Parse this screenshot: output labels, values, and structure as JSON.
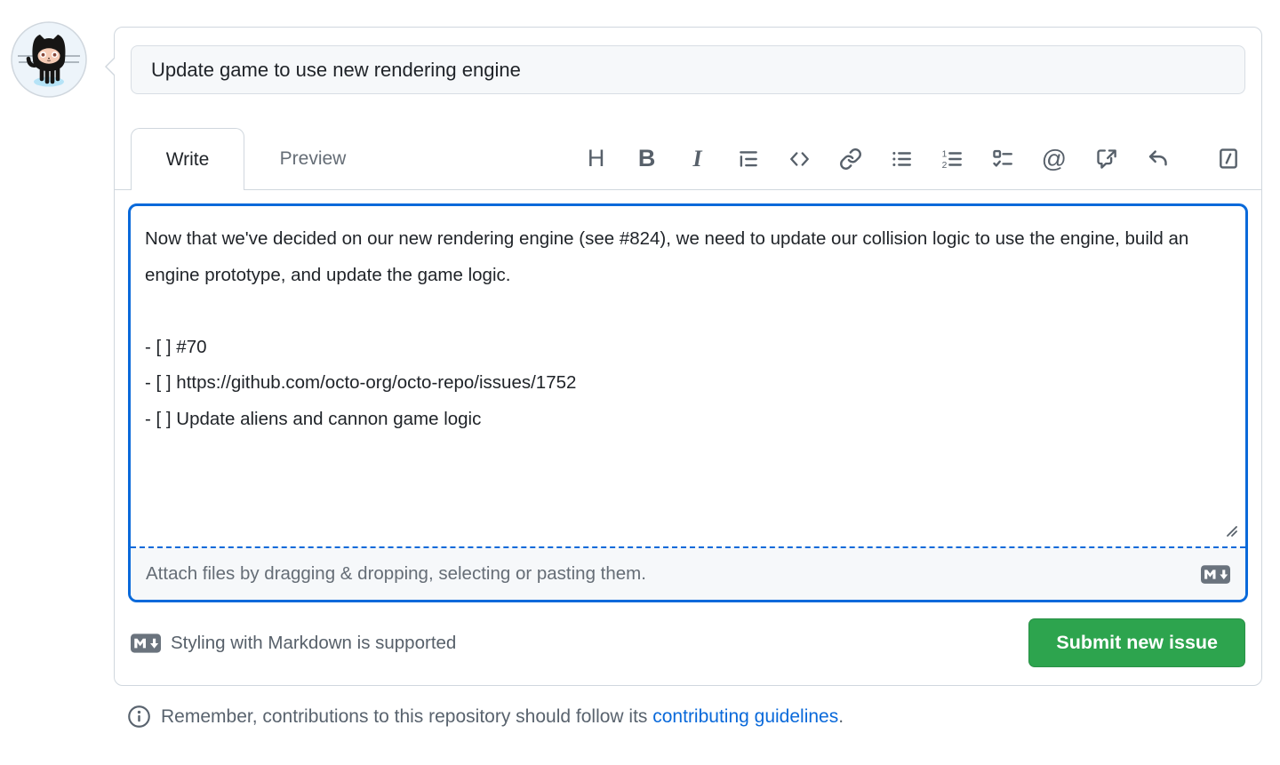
{
  "header": {
    "title_value": "Update game to use new rendering engine"
  },
  "tabs": {
    "write": "Write",
    "preview": "Preview"
  },
  "toolbar": {
    "icons": [
      "heading",
      "bold",
      "italic",
      "quote",
      "code",
      "link",
      "unordered-list",
      "ordered-list",
      "task-list",
      "mention",
      "cross-reference",
      "saved-reply",
      "slash-command"
    ],
    "glyphs": {
      "heading": "H",
      "bold": "B",
      "italic": "I",
      "mention": "@"
    }
  },
  "editor": {
    "body_value": "Now that we've decided on our new rendering engine (see #824), we need to update our collision logic to use the engine, build an engine prototype, and update the game logic.\n\n- [ ] #70\n- [ ] https://github.com/octo-org/octo-repo/issues/1752\n- [ ] Update aliens and cannon game logic",
    "attach_hint": "Attach files by dragging & dropping, selecting or pasting them."
  },
  "actions": {
    "markdown_note": "Styling with Markdown is supported",
    "submit_label": "Submit new issue"
  },
  "footer": {
    "note_prefix": "Remember, contributions to this repository should follow its ",
    "link_text": "contributing guidelines",
    "note_suffix": "."
  },
  "colors": {
    "accent_blue": "#0969da",
    "button_green": "#2da44e",
    "border_gray": "#d0d7de",
    "muted_text": "#656d76",
    "text": "#1f2328",
    "subtle_bg": "#f6f8fa"
  }
}
